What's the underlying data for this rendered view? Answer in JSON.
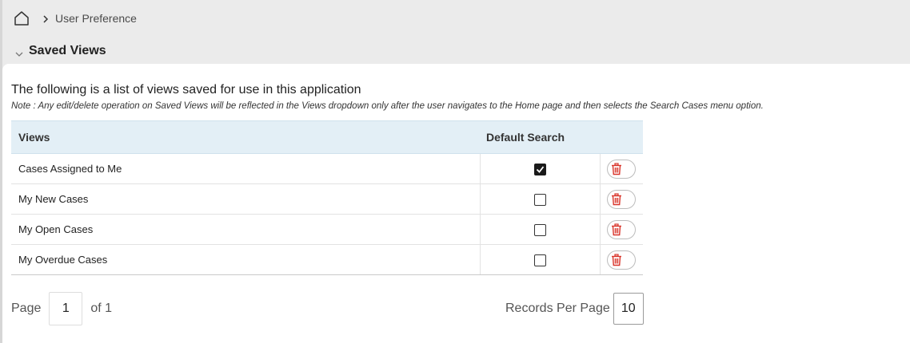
{
  "breadcrumb": {
    "home_icon": "home-icon",
    "separator_icon": "chevron-right-icon",
    "current": "User Preference"
  },
  "section": {
    "title": "Saved Views",
    "toggle_icon": "chevron-down-icon"
  },
  "intro": "The following is a list of views saved for use in this application",
  "note": "Note : Any edit/delete operation on Saved Views will be reflected in the Views dropdown only after the user navigates to the Home page and then selects the Search Cases menu option.",
  "table": {
    "columns": [
      "Views",
      "Default Search",
      ""
    ],
    "rows": [
      {
        "view": "Cases Assigned to Me",
        "default": true
      },
      {
        "view": "My New Cases",
        "default": false
      },
      {
        "view": "My Open Cases",
        "default": false
      },
      {
        "view": "My Overdue Cases",
        "default": false
      }
    ],
    "delete_icon": "trash-icon"
  },
  "pagination": {
    "page_label": "Page",
    "current_page": "1",
    "of_label": "of 1",
    "records_label": "Records Per Page",
    "records_value": "10"
  },
  "colors": {
    "header_bg": "#e3eff6",
    "delete_red": "#d9352b",
    "page_bg": "#ebebeb"
  }
}
